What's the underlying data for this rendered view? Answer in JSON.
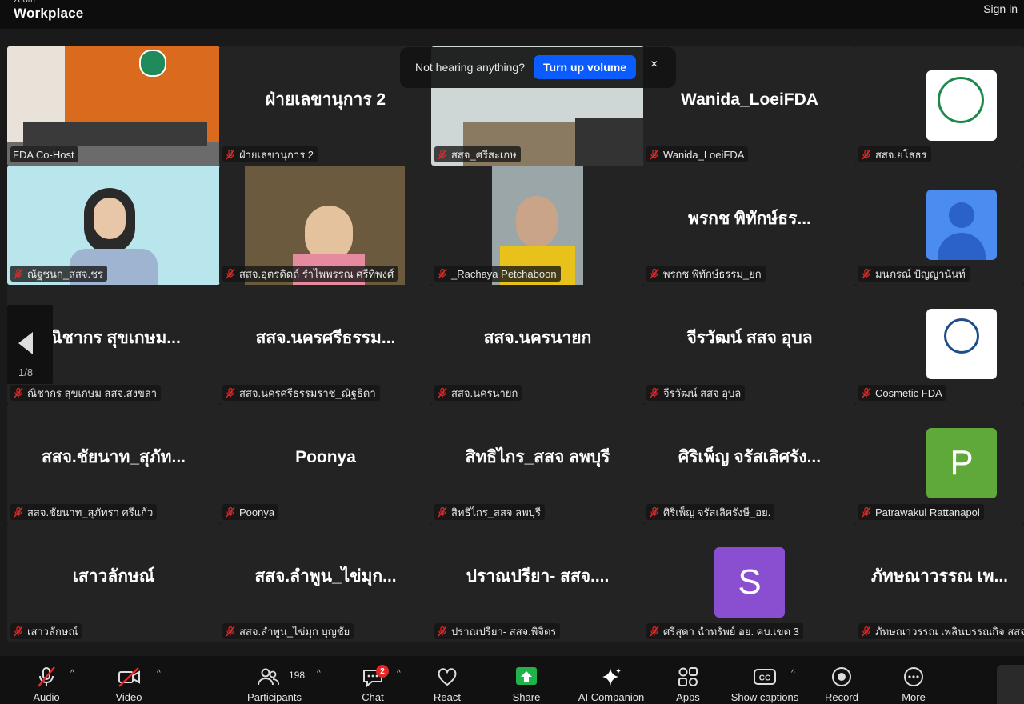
{
  "titlebar": {
    "brand_small": "zoom",
    "brand": "Workplace",
    "signin": "Sign in"
  },
  "notification": {
    "text": "Not hearing anything?",
    "button": "Turn up volume",
    "close": "×"
  },
  "pager": {
    "page": "1/8"
  },
  "tiles": [
    {
      "big": "",
      "name": "FDA Co-Host",
      "muted": false
    },
    {
      "big": "ฝ่ายเลขานุการ 2",
      "name": "ฝ่ายเลขานุการ 2",
      "muted": true
    },
    {
      "big": "",
      "name": "สสจ_ศรีสะเกษ",
      "muted": true
    },
    {
      "big": "Wanida_LoeiFDA",
      "name": "Wanida_LoeiFDA",
      "muted": true
    },
    {
      "big": "",
      "name": "สสจ.ยโสธร",
      "muted": true
    },
    {
      "big": "",
      "name": "ณัฐชนก_สสจ.ชร",
      "muted": true
    },
    {
      "big": "",
      "name": "สสจ.อุตรดิตถ์ รำไพพรรณ ศรีทิพงศ์",
      "muted": true
    },
    {
      "big": "",
      "name": "_Rachaya Petchaboon",
      "muted": true
    },
    {
      "big": "พรกช พิทักษ์ธร...",
      "name": "พรกช พิทักษ์ธรรม_ยก",
      "muted": true
    },
    {
      "big": "",
      "name": "มนภรณ์ ปัญญานันท์",
      "muted": true
    },
    {
      "big": "ณิชากร สุขเกษม...",
      "name": "ณิชากร สุขเกษม สสจ.สงขลา",
      "muted": true
    },
    {
      "big": "สสจ.นครศรีธรรม...",
      "name": "สสจ.นครศรีธรรมราช_ณัฐธิดา",
      "muted": true
    },
    {
      "big": "สสจ.นครนายก",
      "name": "สสจ.นครนายก",
      "muted": true
    },
    {
      "big": "จีรวัฒน์ สสจ อุบล",
      "name": "จีรวัฒน์ สสจ อุบล",
      "muted": true
    },
    {
      "big": "",
      "name": "Cosmetic FDA",
      "muted": true
    },
    {
      "big": "สสจ.ชัยนาท_สุภัท...",
      "name": "สสจ.ชัยนาท_สุภัทรา ศรีแก้ว",
      "muted": true
    },
    {
      "big": "Poonya",
      "name": "Poonya",
      "muted": true
    },
    {
      "big": "สิทธิไกร_สสจ ลพบุรี",
      "name": "สิทธิไกร_สสจ ลพบุรี",
      "muted": true
    },
    {
      "big": "ศิริเพ็ญ จรัสเลิศรัง...",
      "name": "ศิริเพ็ญ จรัสเลิศรังษี_อย.",
      "muted": true
    },
    {
      "big": "",
      "name": "Patrawakul Rattanapol",
      "muted": true
    },
    {
      "big": "เสาวลักษณ์",
      "name": "เสาวลักษณ์",
      "muted": true
    },
    {
      "big": "สสจ.ลำพูน_ไข่มุก...",
      "name": "สสจ.ลำพูน_ไข่มุก บุญชัย",
      "muted": true
    },
    {
      "big": "ปราณปรียา- สสจ....",
      "name": "ปราณปรียา- สสจ.พิจิตร",
      "muted": true
    },
    {
      "big": "",
      "name": "ศรีสุดา ฉ่ำทรัพย์ อย. คบ.เขต 3",
      "muted": true
    },
    {
      "big": "ภัทษณาวรรณ เพ...",
      "name": "ภัทษณาวรรณ เพลินบรรณกิจ สสจ",
      "muted": true
    }
  ],
  "avatars": {
    "p_letter": "P",
    "s_letter": "S"
  },
  "colors": {
    "accent": "#0b5cff",
    "active": "#27c04a",
    "muted_mic": "#e02828",
    "p_avatar": "#5fa83a",
    "s_avatar": "#8a4fd1",
    "person_avatar": "#4a8cf0"
  },
  "toolbar": {
    "audio": "Audio",
    "video": "Video",
    "participants": "Participants",
    "participants_count": "198",
    "chat": "Chat",
    "chat_badge": "2",
    "react": "React",
    "share": "Share",
    "ai": "AI Companion",
    "apps": "Apps",
    "captions": "Show captions",
    "record": "Record",
    "more": "More",
    "caret": "^"
  }
}
